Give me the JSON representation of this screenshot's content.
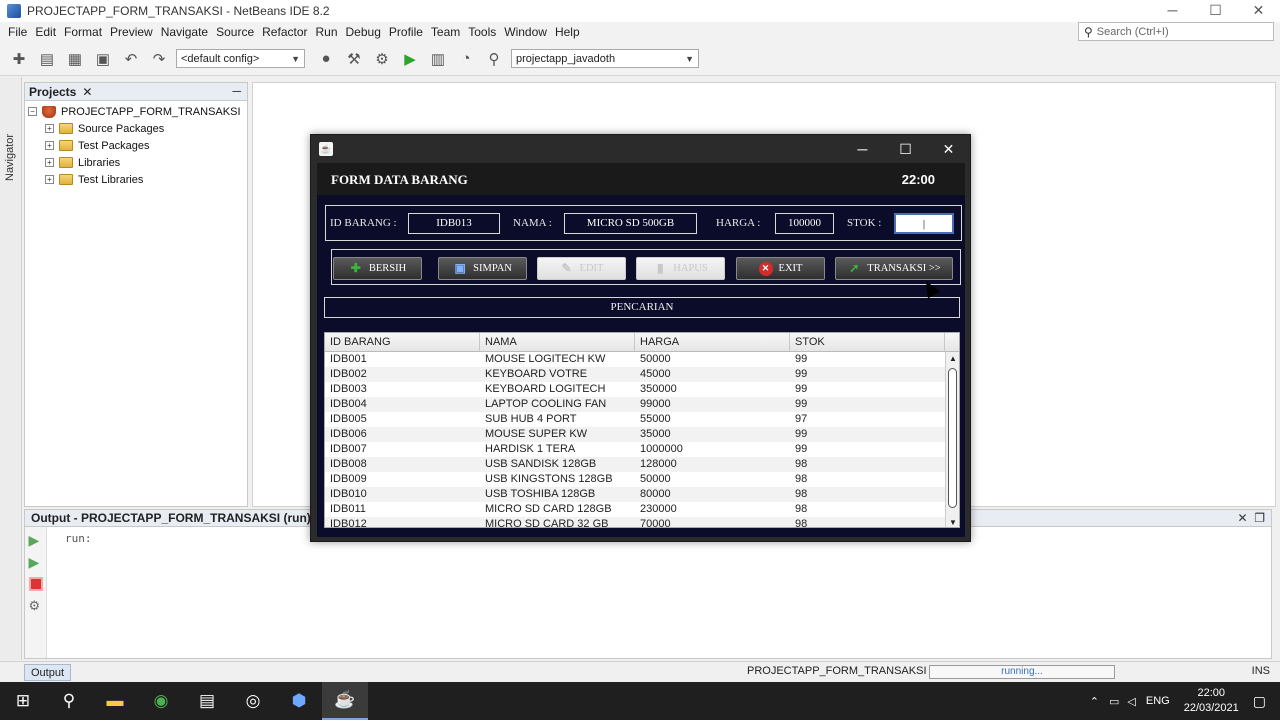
{
  "window": {
    "title": "PROJECTAPP_FORM_TRANSAKSI - NetBeans IDE 8.2"
  },
  "menu": [
    "File",
    "Edit",
    "Format",
    "Preview",
    "Navigate",
    "Source",
    "Refactor",
    "Run",
    "Debug",
    "Profile",
    "Team",
    "Tools",
    "Window",
    "Help"
  ],
  "search": {
    "placeholder": "Search (Ctrl+I)"
  },
  "toolbar": {
    "config": "<default config>",
    "project": "projectapp_javadoth"
  },
  "navigator": {
    "label": "Navigator"
  },
  "projects": {
    "title": "Projects",
    "root": "PROJECTAPP_FORM_TRANSAKSI",
    "children": [
      "Source Packages",
      "Test Packages",
      "Libraries",
      "Test Libraries"
    ]
  },
  "output": {
    "title": "Output - PROJECTAPP_FORM_TRANSAKSI (run)",
    "text": "run:"
  },
  "statusbar": {
    "tab": "Output",
    "project": "PROJECTAPP_FORM_TRANSAKSI (run)",
    "progress": "running...",
    "mode": "INS"
  },
  "taskbar": {
    "lang": "ENG",
    "time": "22:00",
    "date": "22/03/2021"
  },
  "form": {
    "title": "FORM DATA BARANG",
    "clock": "22:00",
    "labels": {
      "id": "ID BARANG :",
      "nama": "NAMA :",
      "harga": "HARGA :",
      "stok": "STOK :"
    },
    "values": {
      "id": "IDB013",
      "nama": "MICRO SD 500GB",
      "harga": "100000",
      "stok": "|"
    },
    "buttons": {
      "bersih": "BERSIH",
      "simpan": "SIMPAN",
      "edit": "EDIT",
      "hapus": "HAPUS",
      "exit": "EXIT",
      "transaksi": "TRANSAKSI >>"
    },
    "search_label": "PENCARIAN",
    "table": {
      "headers": [
        "ID BARANG",
        "NAMA",
        "HARGA",
        "STOK"
      ],
      "rows": [
        [
          "IDB001",
          "MOUSE LOGITECH KW",
          "50000",
          "99"
        ],
        [
          "IDB002",
          "KEYBOARD VOTRE",
          "45000",
          "99"
        ],
        [
          "IDB003",
          "KEYBOARD LOGITECH",
          "350000",
          "99"
        ],
        [
          "IDB004",
          "LAPTOP COOLING FAN",
          "99000",
          "99"
        ],
        [
          "IDB005",
          "SUB HUB 4 PORT",
          "55000",
          "97"
        ],
        [
          "IDB006",
          "MOUSE SUPER KW",
          "35000",
          "99"
        ],
        [
          "IDB007",
          "HARDISK 1 TERA",
          "1000000",
          "99"
        ],
        [
          "IDB008",
          "USB SANDISK 128GB",
          "128000",
          "98"
        ],
        [
          "IDB009",
          "USB KINGSTONS 128GB",
          "50000",
          "98"
        ],
        [
          "IDB010",
          "USB TOSHIBA 128GB",
          "80000",
          "98"
        ],
        [
          "IDB011",
          "MICRO SD CARD 128GB",
          "230000",
          "98"
        ],
        [
          "IDB012",
          "MICRO SD CARD 32 GB",
          "70000",
          "98"
        ]
      ]
    }
  },
  "colors": {
    "dialog_bg": "#0b0b2a",
    "accent_green": "#3bb53b",
    "exit_red": "#d62b2b"
  }
}
